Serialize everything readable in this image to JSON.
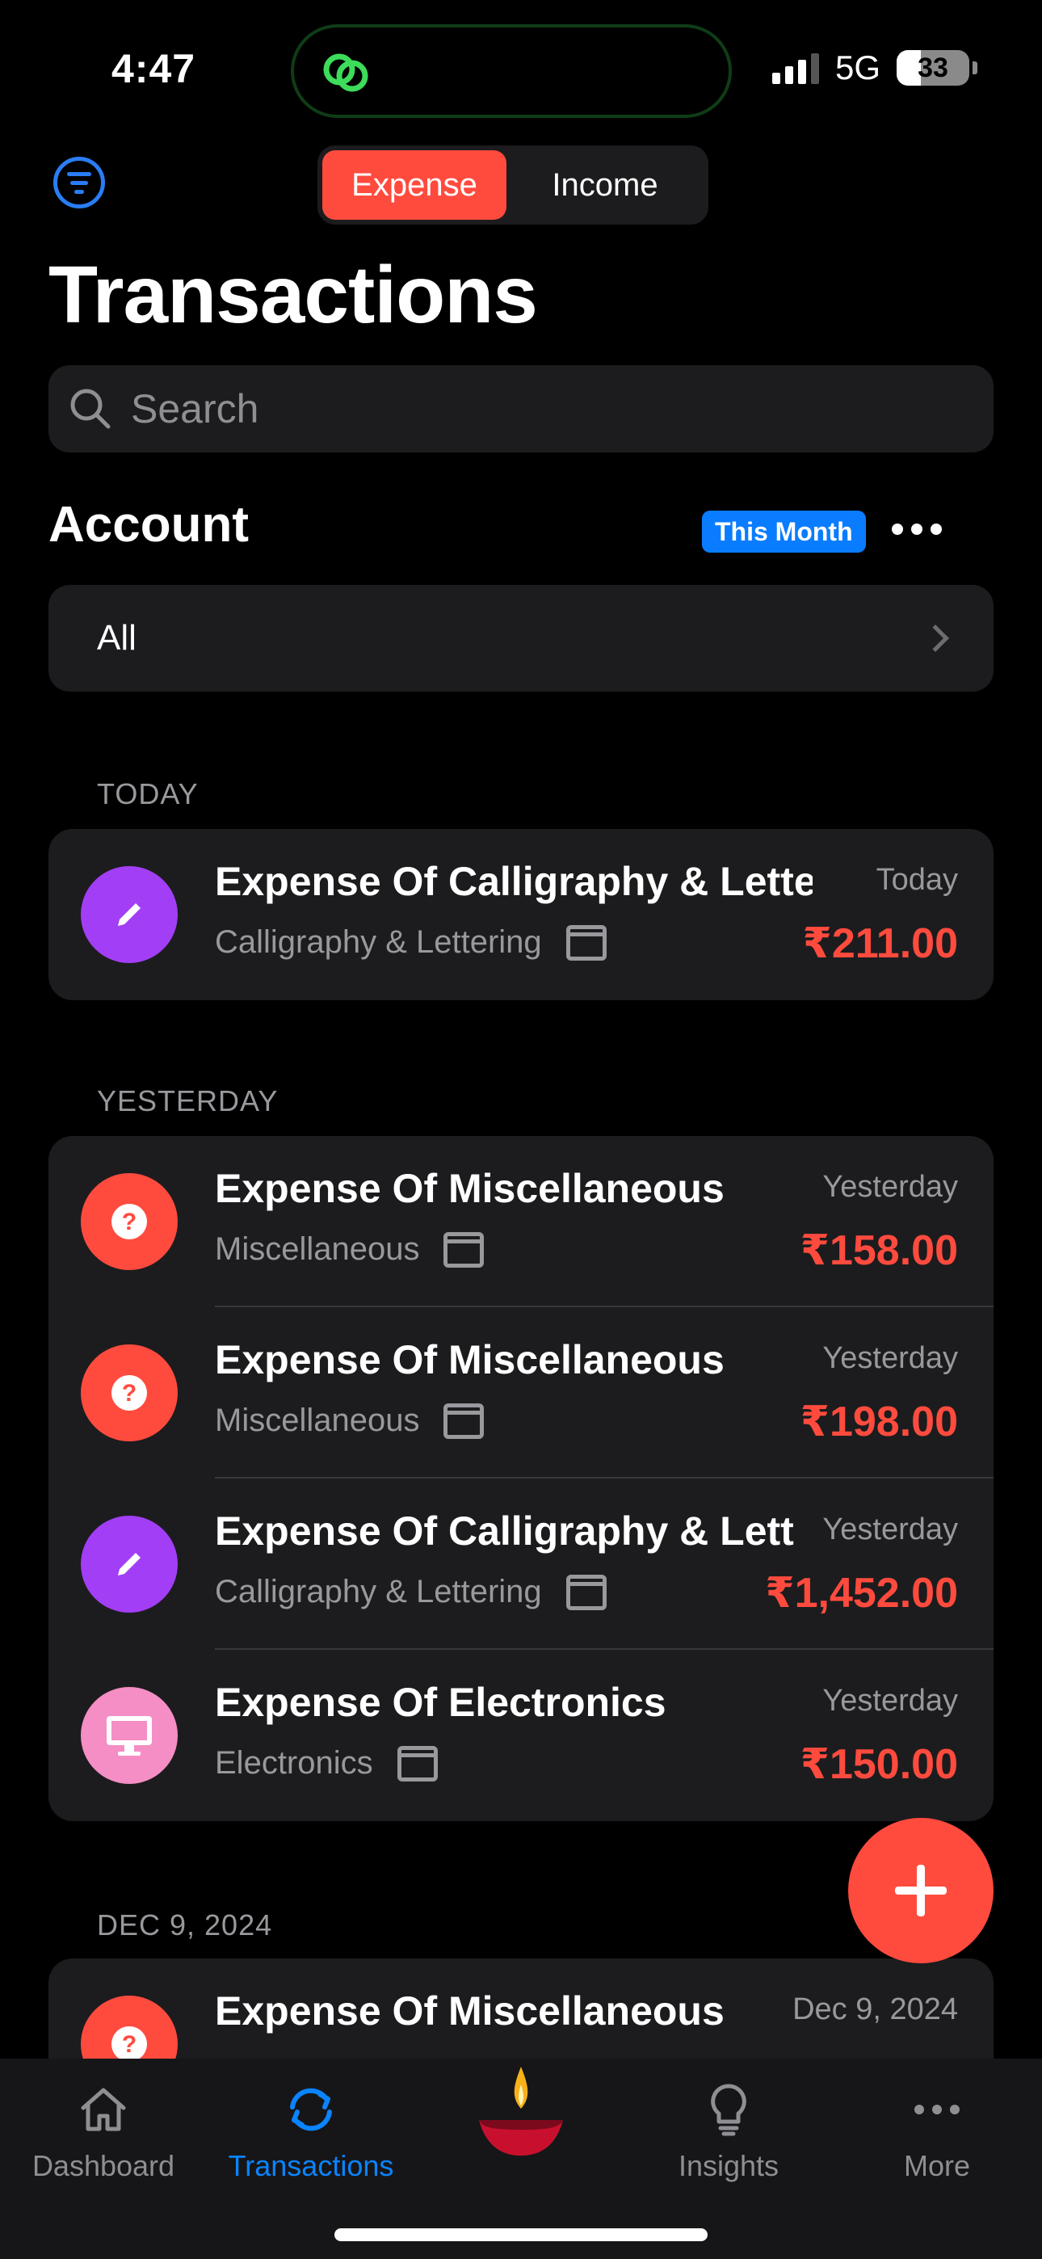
{
  "status_bar": {
    "time": "4:47",
    "network": "5G",
    "battery": "33"
  },
  "header": {
    "segments": [
      {
        "label": "Expense",
        "active": true
      },
      {
        "label": "Income",
        "active": false
      }
    ],
    "title": "Transactions"
  },
  "search": {
    "placeholder": "Search"
  },
  "account": {
    "title": "Account",
    "period_badge": "This Month",
    "selected": "All"
  },
  "sections": [
    {
      "label": "TODAY",
      "transactions": [
        {
          "title": "Expense Of Calligraphy & Letteri",
          "category": "Calligraphy & Lettering",
          "date": "Today",
          "amount": "₹211.00",
          "icon": "pencil-icon",
          "color": "#a23ef5"
        }
      ]
    },
    {
      "label": "YESTERDAY",
      "transactions": [
        {
          "title": "Expense Of Miscellaneous",
          "category": "Miscellaneous",
          "date": "Yesterday",
          "amount": "₹158.00",
          "icon": "question-icon",
          "color": "#ff4b3e"
        },
        {
          "title": "Expense Of Miscellaneous",
          "category": "Miscellaneous",
          "date": "Yesterday",
          "amount": "₹198.00",
          "icon": "question-icon",
          "color": "#ff4b3e"
        },
        {
          "title": "Expense Of Calligraphy & Lett",
          "category": "Calligraphy & Lettering",
          "date": "Yesterday",
          "amount": "₹1,452.00",
          "icon": "pencil-icon",
          "color": "#a23ef5"
        },
        {
          "title": "Expense Of Electronics",
          "category": "Electronics",
          "date": "Yesterday",
          "amount": "₹150.00",
          "icon": "monitor-icon",
          "color": "#f48ec5"
        }
      ]
    },
    {
      "label": "DEC 9, 2024",
      "transactions": [
        {
          "title": "Expense Of Miscellaneous",
          "category": "",
          "date": "Dec 9, 2024",
          "amount": "",
          "icon": "question-icon",
          "color": "#ff4b3e"
        }
      ]
    }
  ],
  "tabbar": {
    "items": [
      {
        "label": "Dashboard",
        "icon": "home-icon",
        "active": false
      },
      {
        "label": "Transactions",
        "icon": "sync-icon",
        "active": true
      },
      {
        "label": "",
        "icon": "diya-icon",
        "active": false
      },
      {
        "label": "Insights",
        "icon": "lightbulb-icon",
        "active": false
      },
      {
        "label": "More",
        "icon": "ellipsis-icon",
        "active": false
      }
    ]
  },
  "colors": {
    "accent_red": "#ff4b3e",
    "accent_blue": "#0a84ff",
    "card_bg": "#1c1c1e",
    "muted_text": "#98989d"
  }
}
